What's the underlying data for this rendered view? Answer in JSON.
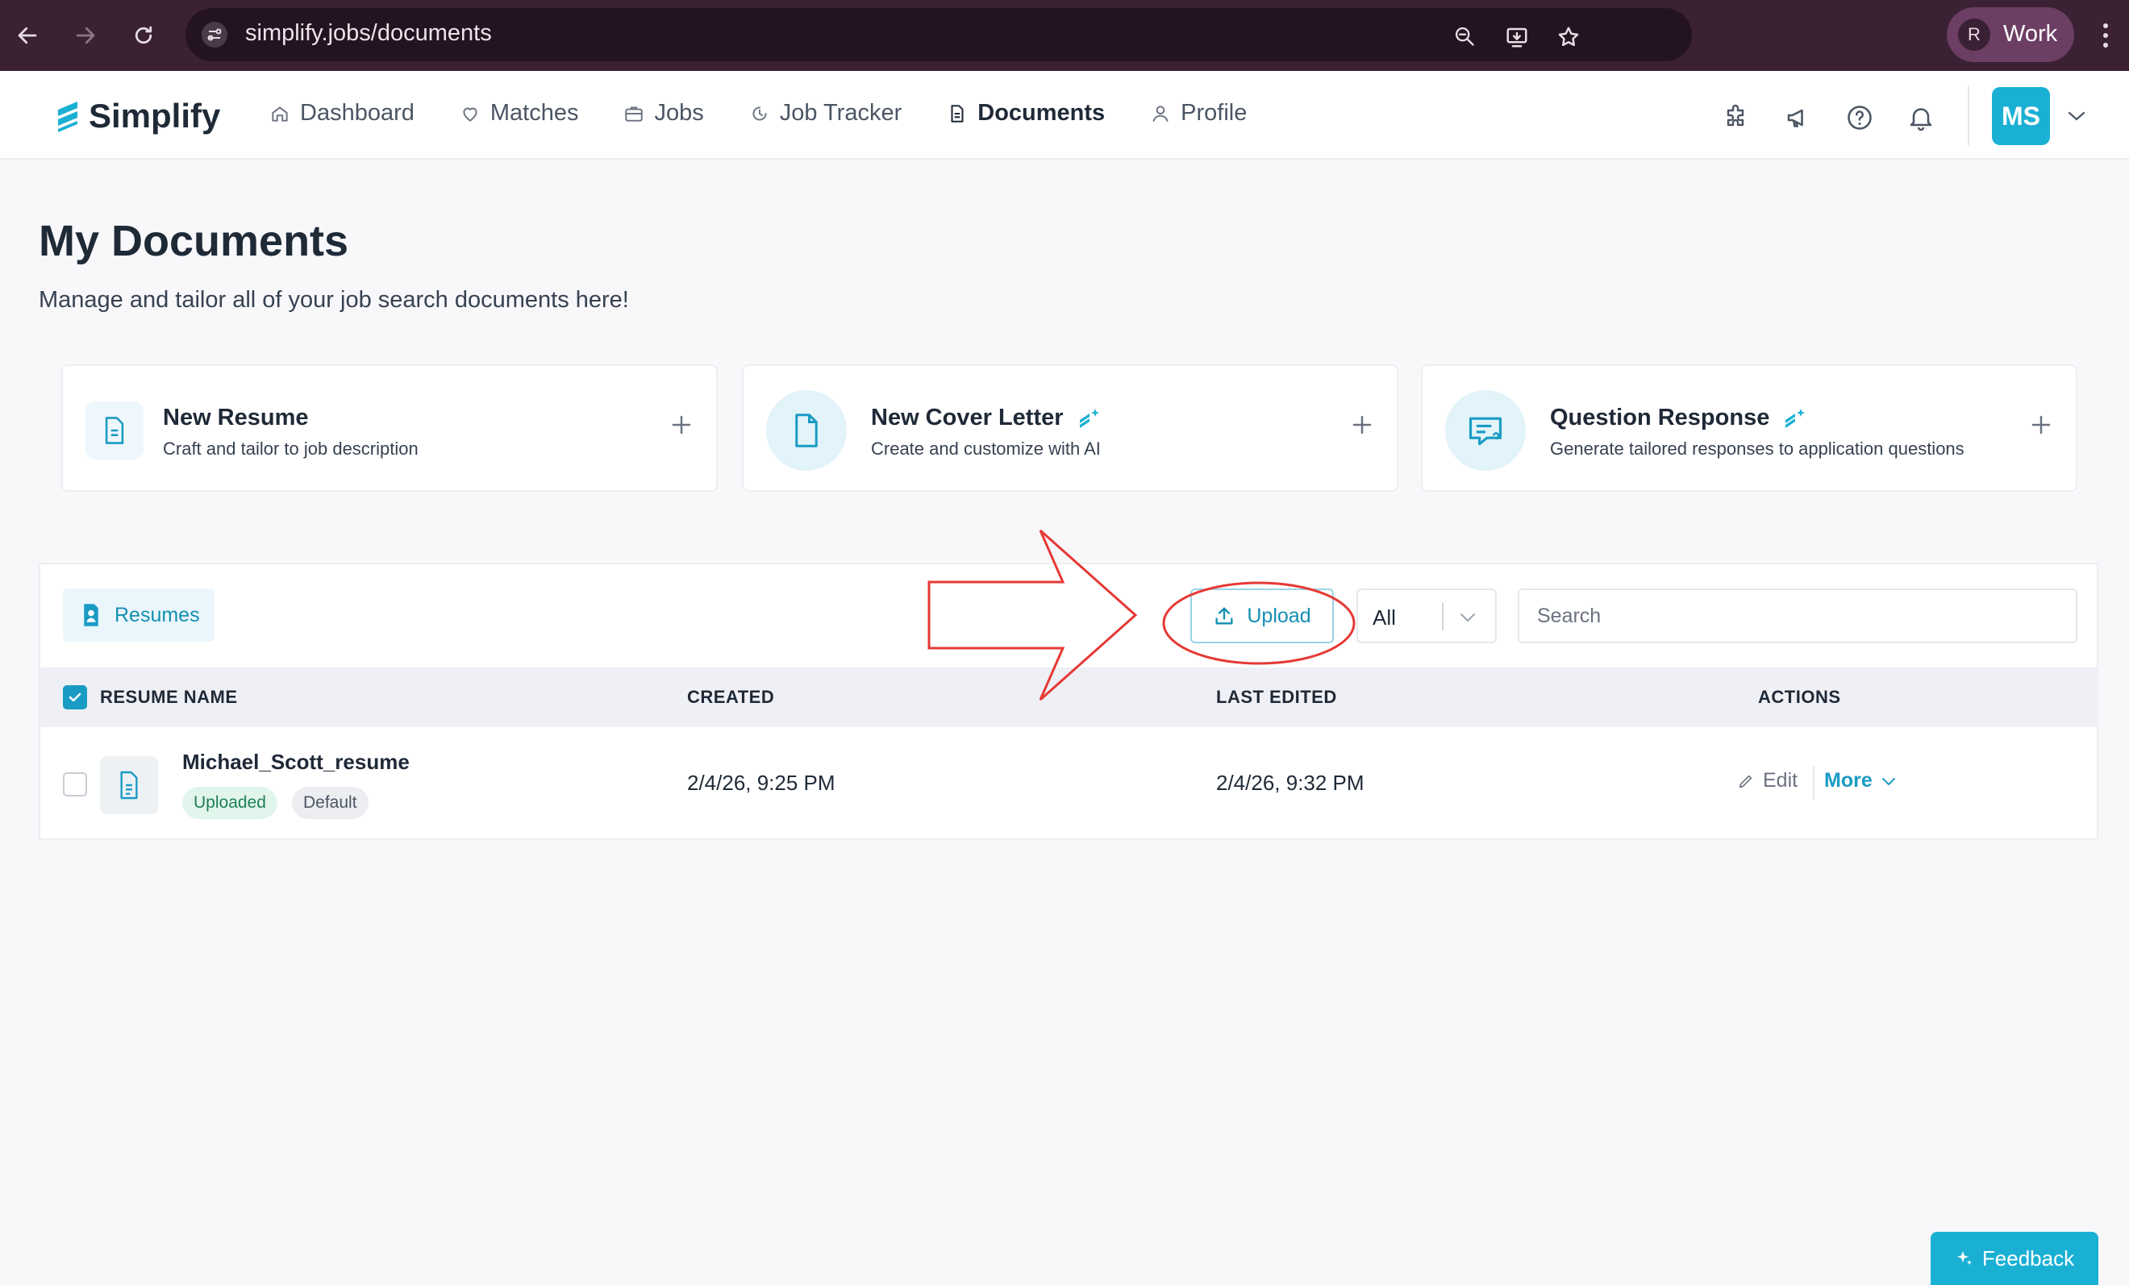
{
  "browser": {
    "url": "simplify.jobs/documents",
    "profile_initial": "R",
    "profile_label": "Work"
  },
  "app": {
    "logo_text": "Simplify",
    "nav": [
      {
        "label": "Dashboard",
        "icon": "home-icon"
      },
      {
        "label": "Matches",
        "icon": "heart-icon"
      },
      {
        "label": "Jobs",
        "icon": "briefcase-icon"
      },
      {
        "label": "Job Tracker",
        "icon": "tracker-icon"
      },
      {
        "label": "Documents",
        "icon": "document-icon",
        "active": true
      },
      {
        "label": "Profile",
        "icon": "user-icon"
      }
    ],
    "user_initials": "MS",
    "brand_color": "#1ab0d4"
  },
  "page": {
    "title": "My Documents",
    "subtitle": "Manage and tailor all of your job search documents here!"
  },
  "cards": [
    {
      "title": "New Resume",
      "desc": "Craft and tailor to job description",
      "ai": false
    },
    {
      "title": "New Cover Letter",
      "desc": "Create and customize with AI",
      "ai": true
    },
    {
      "title": "Question Response",
      "desc": "Generate tailored responses to application questions",
      "ai": true
    }
  ],
  "documents": {
    "tab_label": "Resumes",
    "upload_label": "Upload",
    "filter_value": "All",
    "search_placeholder": "Search",
    "columns": [
      "RESUME NAME",
      "CREATED",
      "LAST EDITED",
      "ACTIONS"
    ],
    "rows": [
      {
        "name": "Michael_Scott_resume",
        "badges": [
          "Uploaded",
          "Default"
        ],
        "created": "2/4/26, 9:25 PM",
        "last_edited": "2/4/26, 9:32 PM",
        "edit_label": "Edit",
        "more_label": "More"
      }
    ]
  },
  "feedback_label": "Feedback",
  "annotation_color": "#e53935"
}
